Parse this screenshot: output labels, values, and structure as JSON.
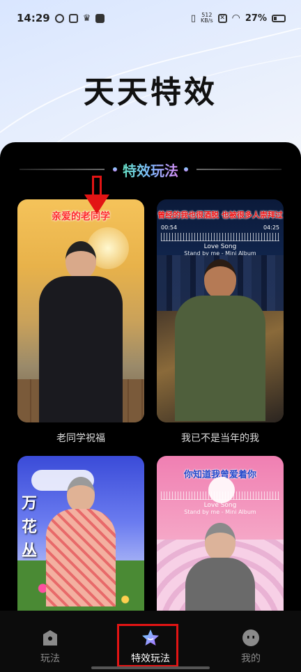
{
  "status_bar": {
    "time": "14:29",
    "net_speed_value": "512",
    "net_speed_unit": "KB/s",
    "battery": "27%"
  },
  "hero": {
    "title": "天天特效"
  },
  "section": {
    "title": "特效玩法"
  },
  "cards": [
    {
      "caption": "老同学祝福",
      "overlay_text": "亲爱的老同学"
    },
    {
      "caption": "我已不是当年的我",
      "overlay_text": "曾经的我也很酒脱  也被很多人崇拜过",
      "music_title": "Love Song",
      "music_sub": "Stand by me - Mini Album",
      "time_start": "00:54",
      "time_end": "04:25"
    },
    {
      "caption": "",
      "overlay_text": "万花丛中"
    },
    {
      "caption": "",
      "overlay_text": "你知道我曾爱着你",
      "music_title": "Love Song",
      "music_sub": "Stand by me - Mini Album"
    }
  ],
  "tabbar": {
    "tabs": [
      {
        "label": "玩法",
        "icon": "play-icon"
      },
      {
        "label": "特效玩法",
        "icon": "star-icon"
      },
      {
        "label": "我的",
        "icon": "profile-icon"
      }
    ],
    "active_index": 1
  },
  "colors": {
    "accent_red": "#e31414",
    "panel_bg": "#000000",
    "section_gradient": [
      "#65e0c4",
      "#7fb8ff",
      "#d68cf3"
    ]
  }
}
